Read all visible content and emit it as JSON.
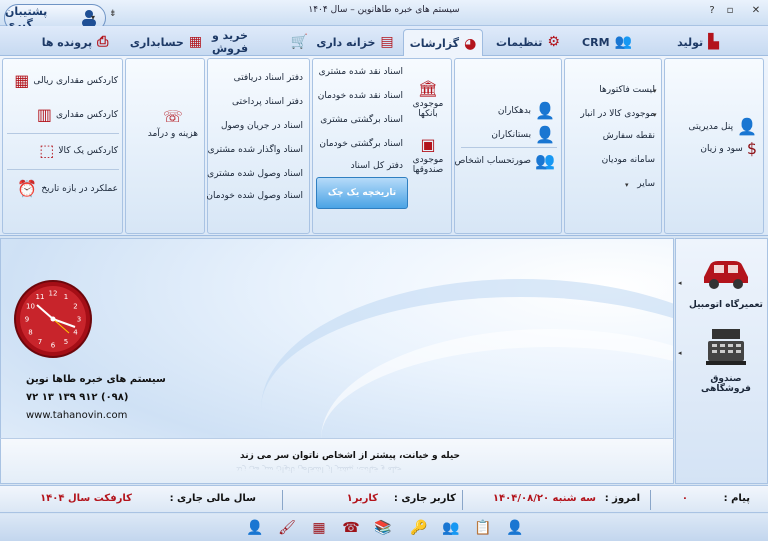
{
  "window": {
    "title": "سیستم های خبره طاهانوین – سال ۱۴۰۴",
    "backup_label": "پشتیبان گیری"
  },
  "tabs": [
    {
      "label": "تولید",
      "icon": "factory-icon"
    },
    {
      "label": "CRM",
      "icon": "users-icon"
    },
    {
      "label": "تنظیمات",
      "icon": "gear-icon"
    },
    {
      "label": "گزارشات",
      "icon": "pie-chart-icon",
      "active": true
    },
    {
      "label": "خزانه داری",
      "icon": "bank-notes-icon"
    },
    {
      "label": "خرید و فروش",
      "icon": "cart-icon"
    },
    {
      "label": "حسابداری",
      "icon": "ledger-icon"
    },
    {
      "label": "پرونده ها",
      "icon": "printer-icon"
    }
  ],
  "ribbon": {
    "group_panel": {
      "items": [
        "پنل مدیریتی",
        "سود و زیان"
      ]
    },
    "group_invoices": {
      "items": [
        "لیست فاکتورها",
        "موجودی کالا در انبار",
        "نقطه سفارش",
        "سامانه مودیان",
        "سایر"
      ]
    },
    "group_persons": {
      "items": [
        "بدهکاران",
        "بستانکاران",
        "صورتحساب اشخاص"
      ]
    },
    "group_bank": {
      "items": [
        "موجودی بانکها",
        "موجودی صندوقها"
      ]
    },
    "group_docs_right": {
      "items": [
        "اسناد نقد شده مشتری",
        "اسناد نقد شده خودمان",
        "اسناد برگشتی مشتری",
        "اسناد برگشتی خودمان",
        "دفتر کل اسناد"
      ],
      "button": "تاریخچه یک چک"
    },
    "group_docs_left": {
      "items": [
        "دفتر اسناد دریافتی",
        "دفتر اسناد پرداختی",
        "اسناد در جریان وصول",
        "اسناد واگذار شده مشتری",
        "اسناد وصول شده مشتری",
        "اسناد وصول شده خودمان"
      ]
    },
    "group_cost": {
      "items": [
        "هزینه و درآمد"
      ]
    },
    "group_cardex": {
      "items": [
        "کاردکس مقداری ریالی",
        "کاردکس مقداری",
        "کاردکس یک کالا",
        "عملکرد در بازه تاریخ"
      ]
    }
  },
  "main": {
    "company_name": "سیستم های خبره طاها نوین",
    "company_phone": "(۰۹۸) ۹۱۲ ۱۳۹ ۱۳ ۷۲",
    "company_web": "www.tahanovin.com",
    "motto": "حیله و خیانت، پیشتر از اشخاص ناتوان سر می زند",
    "clock_numbers": [
      "12",
      "1",
      "2",
      "3",
      "4",
      "5",
      "6",
      "7",
      "8",
      "9",
      "10",
      "11"
    ]
  },
  "side": {
    "items": [
      "تعمیرگاه اتومبیل",
      "صندوق فروشگاهی"
    ]
  },
  "status": {
    "message_label": "پیام :",
    "message_value": "۰",
    "today_label": "امروز :",
    "today_value": "سه شنبه  ۱۴۰۴/۰۸/۲۰",
    "user_label": "کاربر جاری :",
    "user_value": "کاربر۱",
    "fiscal_label": "سال مالی جاری :",
    "fiscal_value": "کارفکت سال ۱۴۰۴"
  },
  "bottom_toolbar": {
    "icons": [
      "user-icon",
      "brush-icon",
      "calculator-icon",
      "phone-icon",
      "books-icon",
      "key-icon",
      "users-search-icon",
      "notes-icon",
      "user-check-icon"
    ]
  },
  "colors": {
    "accent": "#b3141c",
    "ribbon_bg": "#dbe8f7",
    "button_blue": "#4aa3e5"
  }
}
